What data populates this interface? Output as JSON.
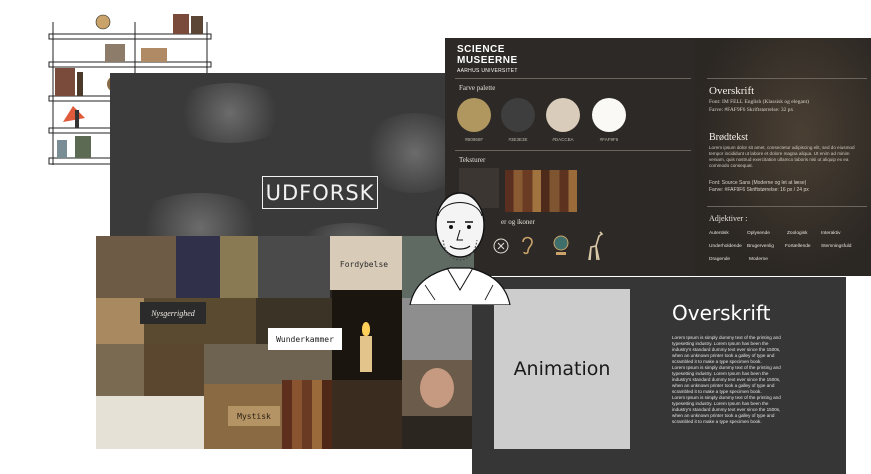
{
  "colors": {
    "slide_dark": "#3a3a3a",
    "guide_bg": "#2c2926",
    "anim_bg": "#363636",
    "anim_box": "#cdcdcd"
  },
  "udforsk": {
    "title": "UDFORSK"
  },
  "guide": {
    "logo_line1": "SCIENCE",
    "logo_line2": "MUSEERNE",
    "logo_line3": "AARHUS UNIVERSITET",
    "palette_label": "Farve palette",
    "swatches": [
      {
        "code": "#B0965F",
        "color": "#b0965f"
      },
      {
        "code": "#3E3E3E",
        "color": "#3e3e3e"
      },
      {
        "code": "#DACCBA",
        "color": "#daccba"
      },
      {
        "code": "#FAF9F6",
        "color": "#faf9f6"
      }
    ],
    "texture_label": "Teksturer",
    "icons_label": "er og ikoner",
    "heading_title": "Overskrift",
    "heading_font": "Font: IM FELL English (Klassisk og elegant)",
    "heading_color": "Farve: #FAF9F6  Skriftstørrelse: 32 px",
    "body_title": "Brødtekst",
    "body_lorem": "Lorem ipsum dolor sit amet, consectetur adipiscing elit, sed do eiusmod tempor incididunt ut labore et dolore magna aliqua. Ut enim ad minim veniam, quis nostrud exercitation ullamco laboris nisi ut aliquip ex ea commodo consequat.",
    "body_font": "Font: Source Sans (Moderne og let at læse)",
    "body_color": "Farve: #FAF9F6  Skriftstørrelse: 16 px / 24 px",
    "adjectives_label": "Adjektiver :",
    "adjectives": [
      "Autentisk",
      "Oplysende",
      "Zoologisk",
      "Interaktiv",
      "Underholdende",
      "Brugervenlig",
      "Fortællende",
      "Stemningsfuld",
      "Dragende",
      "Moderne"
    ]
  },
  "moodboard": {
    "words": [
      "Nysgerrighed",
      "Fordybelse",
      "Wunderkammer",
      "Mystisk"
    ]
  },
  "animation": {
    "box_label": "Animation",
    "title": "Overskrift",
    "paragraphs": [
      "Lorem Ipsum is simply dummy text of the printing and typesetting industry. Lorem Ipsum has been the industry's standard dummy text ever since the 1500s, when an unknown printer took a galley of type and scrambled it to make a type specimen book.",
      "Lorem Ipsum is simply dummy text of the printing and typesetting industry. Lorem Ipsum has been the industry's standard dummy text ever since the 1500s, when an unknown printer took a galley of type and scrambled it to make a type specimen book.",
      "Lorem Ipsum is simply dummy text of the printing and typesetting industry. Lorem Ipsum has been the industry's standard dummy text ever since the 1500s, when an unknown printer took a galley of type and scrambled it to make a type specimen book."
    ]
  }
}
